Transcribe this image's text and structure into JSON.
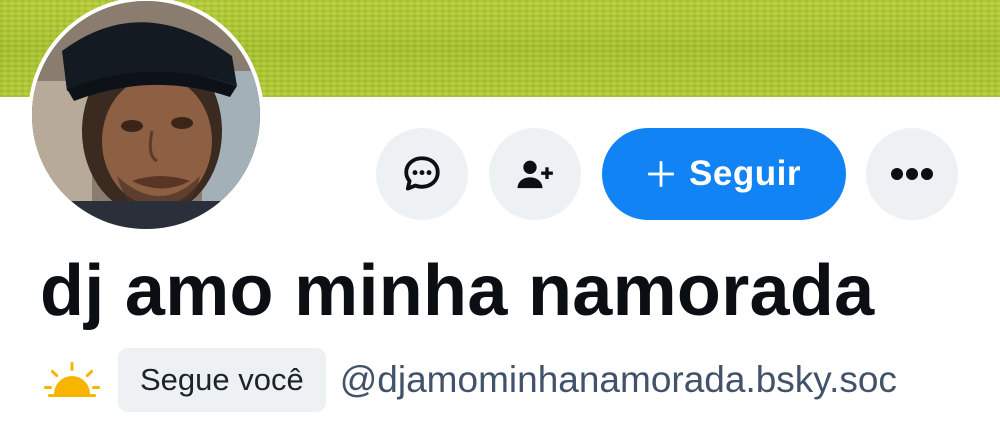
{
  "profile": {
    "display_name": "dj amo minha namorada",
    "handle": "@djamominhanamorada.bsky.soc",
    "follows_you_label": "Segue você",
    "status_emoji": "sunrise-emoji"
  },
  "actions": {
    "follow_label": "Seguir",
    "message_icon": "chat-bubble-icon",
    "add_user_icon": "person-add-icon",
    "more_icon": "ellipsis-icon",
    "follow_icon": "plus-icon"
  },
  "colors": {
    "banner": "#b3cc33",
    "accent": "#1283f5",
    "button_bg": "#eef1f4",
    "name_text": "#0b0f14",
    "handle_text": "#41526a"
  }
}
